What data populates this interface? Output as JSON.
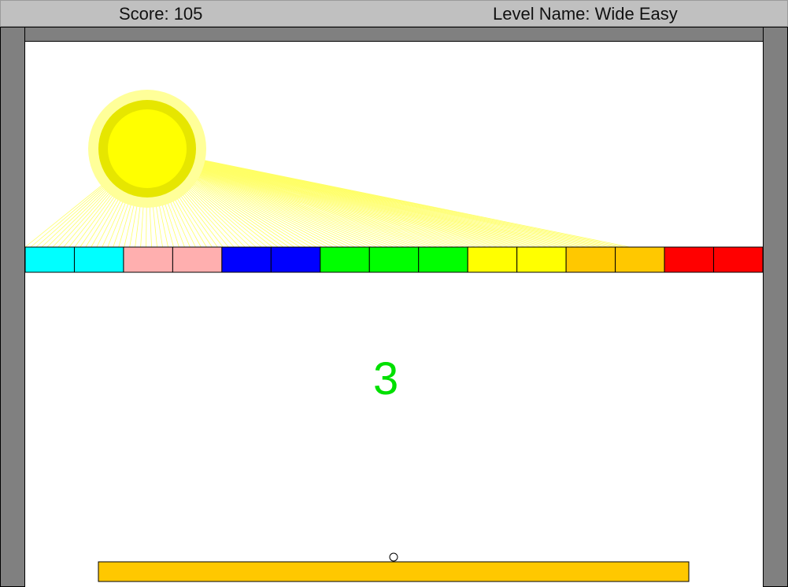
{
  "hud": {
    "score_text": "Score: 105",
    "level_text": "Level Name: Wide Easy"
  },
  "countdown": "3",
  "colors": {
    "hud_background": "#c0c0c0",
    "wall": "#808080",
    "field": "#ffffff",
    "sun_outer_glow": "#ffff99",
    "sun_ring": "#e6e600",
    "sun_core": "#ffff00",
    "sun_rays": "#ffff66",
    "paddle": "#ffc800",
    "ball_fill": "#ffffff",
    "ball_stroke": "#000000",
    "countdown_text": "#00e000"
  },
  "blocks": [
    "#00ffff",
    "#00ffff",
    "#ffafaf",
    "#ffafaf",
    "#0000ff",
    "#0000ff",
    "#00ff00",
    "#00ff00",
    "#00ff00",
    "#ffff00",
    "#ffff00",
    "#ffc800",
    "#ffc800",
    "#ff0000",
    "#ff0000"
  ]
}
